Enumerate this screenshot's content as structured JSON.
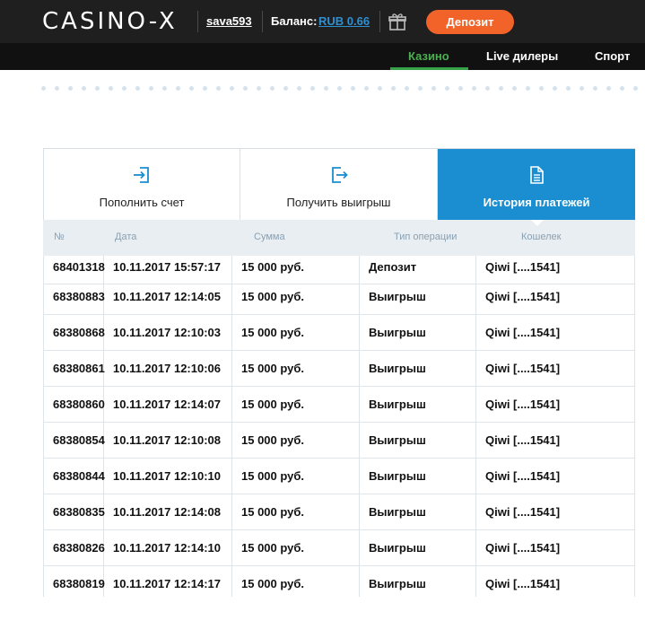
{
  "header": {
    "logo": "CASINO-X",
    "username": "sava593",
    "balance_label": "Баланс:",
    "balance_value": "RUB 0.66",
    "gift_icon": "gift-icon",
    "deposit_label": "Депозит",
    "accent_color": "#f2632a"
  },
  "nav": {
    "items": [
      {
        "label": "Казино",
        "active": true
      },
      {
        "label": "Live дилеры",
        "active": false
      },
      {
        "label": "Спорт",
        "active": false
      }
    ]
  },
  "tabs": [
    {
      "label": "Пополнить счет",
      "icon": "login-icon",
      "active": false
    },
    {
      "label": "Получить выигрыш",
      "icon": "logout-icon",
      "active": false
    },
    {
      "label": "История платежей",
      "icon": "document-icon",
      "active": true
    }
  ],
  "table": {
    "columns": [
      "№",
      "Дата",
      "Сумма",
      "Тип операции",
      "Кошелек"
    ],
    "rows": [
      [
        "68401318",
        "10.11.2017 15:57:17",
        "15 000 руб.",
        "Депозит",
        "Qiwi [....1541]"
      ],
      [
        "68380883",
        "10.11.2017 12:14:05",
        "15 000 руб.",
        "Выигрыш",
        "Qiwi [....1541]"
      ],
      [
        "68380868",
        "10.11.2017 12:10:03",
        "15 000 руб.",
        "Выигрыш",
        "Qiwi [....1541]"
      ],
      [
        "68380861",
        "10.11.2017 12:10:06",
        "15 000 руб.",
        "Выигрыш",
        "Qiwi [....1541]"
      ],
      [
        "68380860",
        "10.11.2017 12:14:07",
        "15 000 руб.",
        "Выигрыш",
        "Qiwi [....1541]"
      ],
      [
        "68380854",
        "10.11.2017 12:10:08",
        "15 000 руб.",
        "Выигрыш",
        "Qiwi [....1541]"
      ],
      [
        "68380844",
        "10.11.2017 12:10:10",
        "15 000 руб.",
        "Выигрыш",
        "Qiwi [....1541]"
      ],
      [
        "68380835",
        "10.11.2017 12:14:08",
        "15 000 руб.",
        "Выигрыш",
        "Qiwi [....1541]"
      ],
      [
        "68380826",
        "10.11.2017 12:14:10",
        "15 000 руб.",
        "Выигрыш",
        "Qiwi [....1541]"
      ],
      [
        "68380819",
        "10.11.2017 12:14:17",
        "15 000 руб.",
        "Выигрыш",
        "Qiwi [....1541]"
      ]
    ]
  },
  "colors": {
    "header_bg": "#1f1f1f",
    "active_tab": "#1a8ed0",
    "nav_active": "#37a349",
    "balance_link": "#2f8fd0"
  }
}
